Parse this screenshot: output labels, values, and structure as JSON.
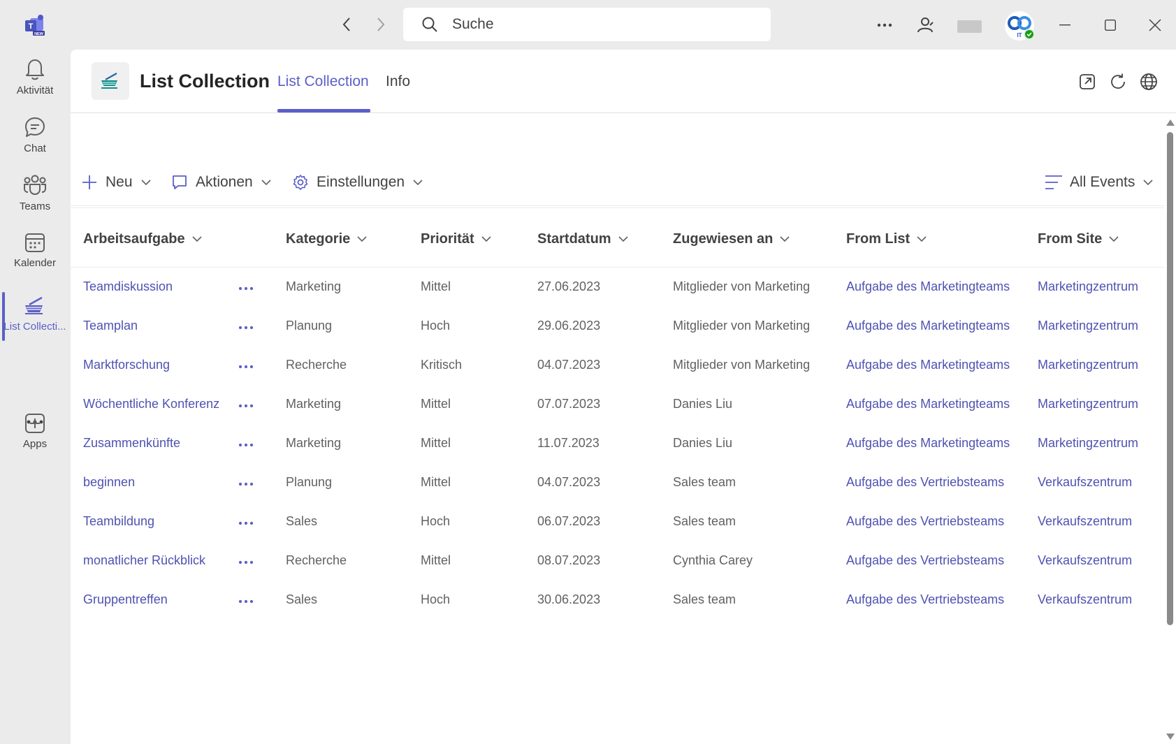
{
  "titlebar": {
    "app_logo": "teams-new-logo-icon",
    "search_placeholder": "Suche",
    "icons": [
      "chevron-left-icon",
      "chevron-right-icon",
      "search-icon",
      "more-icon",
      "people-icon",
      "minimize-icon",
      "maximize-icon",
      "close-icon"
    ],
    "presence_status": "available"
  },
  "rail": {
    "items": [
      {
        "label": "Aktivität",
        "icon": "bell-icon"
      },
      {
        "label": "Chat",
        "icon": "chat-icon"
      },
      {
        "label": "Teams",
        "icon": "teams-icon"
      },
      {
        "label": "Kalender",
        "icon": "calendar-icon"
      },
      {
        "label": "List Collecti...",
        "icon": "list-collection-icon",
        "active": true
      },
      {
        "label": "Apps",
        "icon": "add-apps-icon"
      }
    ]
  },
  "header": {
    "title": "List Collection",
    "tabs": [
      {
        "label": "List Collection",
        "active": true
      },
      {
        "label": "Info",
        "active": false
      }
    ],
    "icons": [
      "popout-icon",
      "refresh-icon",
      "globe-icon"
    ]
  },
  "toolbar": {
    "new_label": "Neu",
    "actions_label": "Aktionen",
    "settings_label": "Einstellungen",
    "view_label": "All Events"
  },
  "table": {
    "columns": [
      "Arbeitsaufgabe",
      "Kategorie",
      "Priorität",
      "Startdatum",
      "Zugewiesen an",
      "From List",
      "From Site"
    ],
    "rows": [
      [
        "Teamdiskussion",
        "Marketing",
        "Mittel",
        "27.06.2023",
        "Mitglieder von Marketing",
        "Aufgabe des Marketingteams",
        "Marketingzentrum"
      ],
      [
        "Teamplan",
        "Planung",
        "Hoch",
        "29.06.2023",
        "Mitglieder von Marketing",
        "Aufgabe des Marketingteams",
        "Marketingzentrum"
      ],
      [
        "Marktforschung",
        "Recherche",
        "Kritisch",
        "04.07.2023",
        "Mitglieder von Marketing",
        "Aufgabe des Marketingteams",
        "Marketingzentrum"
      ],
      [
        "Wöchentliche Konferenz",
        "Marketing",
        "Mittel",
        "07.07.2023",
        "Danies Liu",
        "Aufgabe des Marketingteams",
        "Marketingzentrum"
      ],
      [
        "Zusammenkünfte",
        "Marketing",
        "Mittel",
        "11.07.2023",
        "Danies Liu",
        "Aufgabe des Marketingteams",
        "Marketingzentrum"
      ],
      [
        "beginnen",
        "Planung",
        "Mittel",
        "04.07.2023",
        "Sales team",
        "Aufgabe des Vertriebsteams",
        "Verkaufszentrum"
      ],
      [
        "Teambildung",
        "Sales",
        "Hoch",
        "06.07.2023",
        "Sales team",
        "Aufgabe des Vertriebsteams",
        "Verkaufszentrum"
      ],
      [
        "monatlicher Rückblick",
        "Recherche",
        "Mittel",
        "08.07.2023",
        "Cynthia Carey",
        "Aufgabe des Vertriebsteams",
        "Verkaufszentrum"
      ],
      [
        "Gruppentreffen",
        "Sales",
        "Hoch",
        "30.06.2023",
        "Sales team",
        "Aufgabe des Vertriebsteams",
        "Verkaufszentrum"
      ]
    ]
  },
  "colors": {
    "accent": "#5b5fc7",
    "link": "#4f52b2",
    "chrome": "#ebebeb",
    "presence": "#13a10e"
  }
}
